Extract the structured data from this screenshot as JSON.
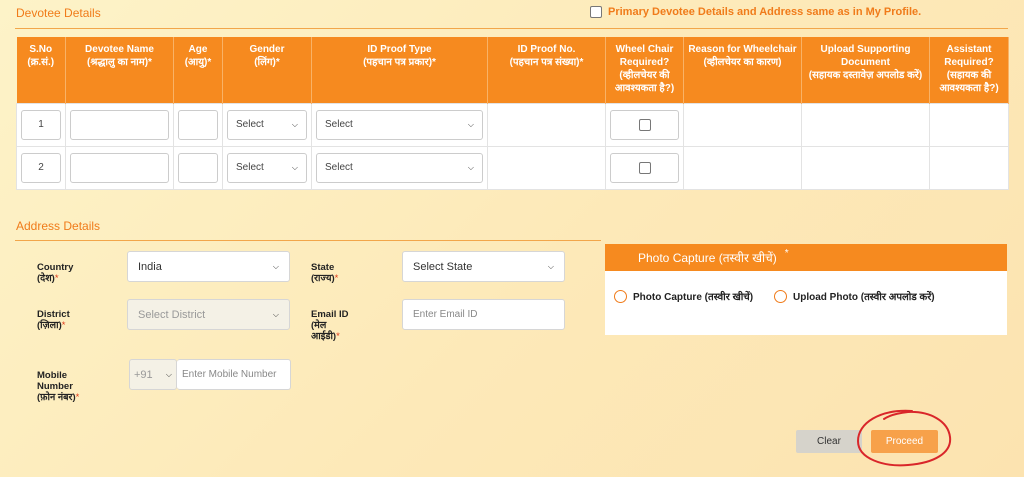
{
  "devotee": {
    "title": "Devotee Details",
    "primary_checkbox_label": "Primary Devotee Details and Address same as in My Profile.",
    "columns": [
      {
        "en": "S.No",
        "hi": "(क्र.सं.)"
      },
      {
        "en": "Devotee Name",
        "hi": "(श्रद्धालु का नाम)*"
      },
      {
        "en": "Age",
        "hi": "(आयु)*"
      },
      {
        "en": "Gender",
        "hi": "(लिंग)*"
      },
      {
        "en": "ID Proof Type",
        "hi": "(पहचान पत्र प्रकार)*"
      },
      {
        "en": "ID Proof No.",
        "hi": "(पहचान पत्र संख्या)*"
      },
      {
        "en": "Wheel Chair Required?",
        "hi": "(व्हीलचेयर की आवश्यकता है?)"
      },
      {
        "en": "Reason for Wheelchair",
        "hi": "(व्हीलचेयर का कारण)"
      },
      {
        "en": "Upload Supporting Document",
        "hi": "(सहायक दस्तावेज़ अपलोड करें)"
      },
      {
        "en": "Assistant Required?",
        "hi": "(सहायक की आवश्यकता है?)"
      }
    ],
    "rows": [
      {
        "sno": "1",
        "gender": "Select",
        "id_type": "Select"
      },
      {
        "sno": "2",
        "gender": "Select",
        "id_type": "Select"
      }
    ]
  },
  "address": {
    "title": "Address Details",
    "country_label": "Country",
    "country_label_hi": "(देश)",
    "country_value": "India",
    "state_label": "State",
    "state_label_hi": "(राज्य)",
    "state_value": "Select State",
    "district_label": "District",
    "district_label_hi": "(ज़िला)",
    "district_value": "Select District",
    "email_label": "Email ID",
    "email_label_hi1": "(मेल",
    "email_label_hi2": "आईडी)",
    "email_placeholder": "Enter Email ID",
    "mobile_label1": "Mobile",
    "mobile_label2": "Number",
    "mobile_label_hi": "(फ़ोन नंबर)",
    "country_code": "+91",
    "mobile_placeholder": "Enter Mobile Number",
    "required_star": "*"
  },
  "photo": {
    "title": "Photo Capture (तस्वीर खीचें)",
    "star": "*",
    "option_capture": "Photo Capture (तस्वीर खीचें)",
    "option_upload": "Upload Photo (तस्वीर अपलोड करें)"
  },
  "actions": {
    "clear": "Clear",
    "proceed": "Proceed"
  },
  "colors": {
    "accent": "#f68a1f",
    "title": "#f07b1a",
    "annotation": "#d9262a"
  }
}
